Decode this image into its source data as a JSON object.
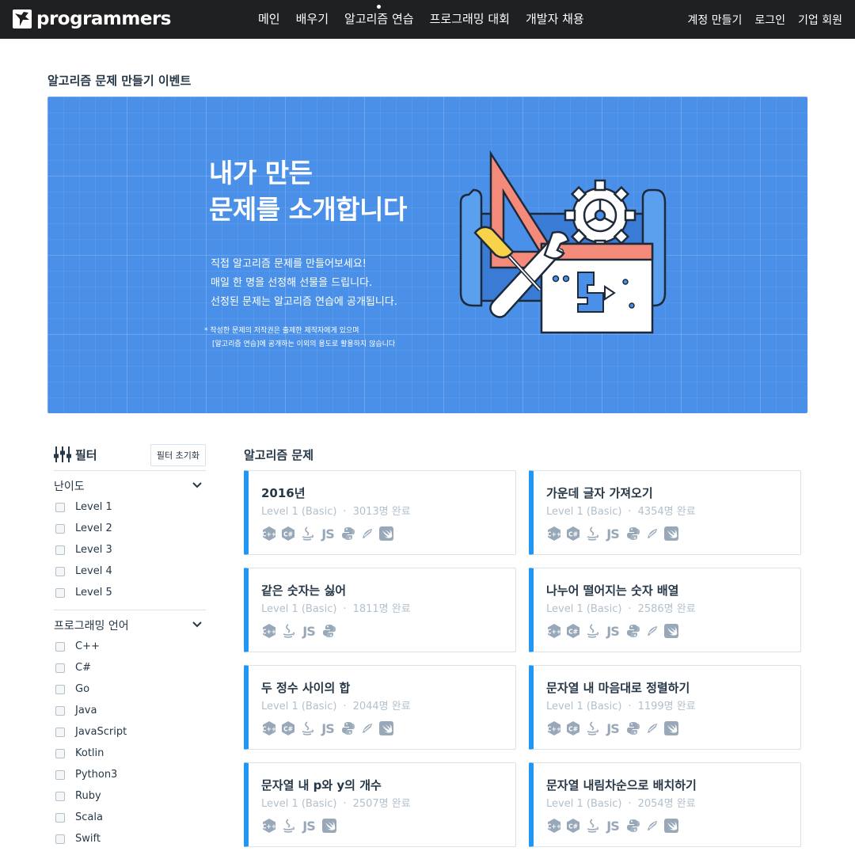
{
  "brand": {
    "name": "programmers"
  },
  "nav": {
    "items": [
      {
        "label": "메인",
        "active": false
      },
      {
        "label": "배우기",
        "active": false
      },
      {
        "label": "알고리즘 연습",
        "active": true
      },
      {
        "label": "프로그래밍 대회",
        "active": false
      },
      {
        "label": "개발자 채용",
        "active": false
      }
    ],
    "right": {
      "signup": "계정 만들기",
      "login": "로그인",
      "company": "기업 회원"
    }
  },
  "event": {
    "section_title": "알고리즘 문제 만들기 이벤트",
    "banner": {
      "headline_1": "내가 만든",
      "headline_2": "문제를 소개합니다",
      "sub_1": "직접 알고리즘 문제를 만들어보세요!",
      "sub_2": "매일 한 명을 선정해 선물을 드립니다.",
      "sub_3": "선정된 문제는 알고리즘 연습에 공개됩니다.",
      "note_1": "*  작성한 문제의 저작권은 출제한 제작자에게 있으며",
      "note_2": "[알고리즘 연습]에 공개하는 이외의 용도로 활용하지 않습니다"
    }
  },
  "filter": {
    "title": "필터",
    "reset_label": "필터 초기화",
    "difficulty": {
      "title": "난이도",
      "options": [
        "Level 1",
        "Level 2",
        "Level 3",
        "Level 4",
        "Level 5"
      ]
    },
    "language": {
      "title": "프로그래밍 언어",
      "options": [
        "C++",
        "C#",
        "Go",
        "Java",
        "JavaScript",
        "Kotlin",
        "Python3",
        "Ruby",
        "Scala",
        "Swift"
      ]
    }
  },
  "problems": {
    "title": "알고리즘 문제",
    "items": [
      {
        "title": "2016년",
        "level": "Level 1 (Basic)",
        "completed": "3013명 완료",
        "langs": [
          "cpp",
          "csharp",
          "java",
          "js",
          "python",
          "scala",
          "swift"
        ]
      },
      {
        "title": "가운데 글자 가져오기",
        "level": "Level 1 (Basic)",
        "completed": "4354명 완료",
        "langs": [
          "cpp",
          "csharp",
          "java",
          "js",
          "python",
          "scala",
          "swift"
        ]
      },
      {
        "title": "같은 숫자는 싫어",
        "level": "Level 1 (Basic)",
        "completed": "1811명 완료",
        "langs": [
          "cpp",
          "java",
          "js",
          "python"
        ]
      },
      {
        "title": "나누어 떨어지는 숫자 배열",
        "level": "Level 1 (Basic)",
        "completed": "2586명 완료",
        "langs": [
          "cpp",
          "csharp",
          "java",
          "js",
          "python",
          "scala",
          "swift"
        ]
      },
      {
        "title": "두 정수 사이의 합",
        "level": "Level 1 (Basic)",
        "completed": "2044명 완료",
        "langs": [
          "cpp",
          "csharp",
          "java",
          "js",
          "python",
          "scala",
          "swift"
        ]
      },
      {
        "title": "문자열 내 마음대로 정렬하기",
        "level": "Level 1 (Basic)",
        "completed": "1199명 완료",
        "langs": [
          "cpp",
          "csharp",
          "java",
          "js",
          "python",
          "scala",
          "swift"
        ]
      },
      {
        "title": "문자열 내 p와 y의 개수",
        "level": "Level 1 (Basic)",
        "completed": "2507명 완료",
        "langs": [
          "cpp",
          "java",
          "js",
          "swift"
        ]
      },
      {
        "title": "문자열 내림차순으로 배치하기",
        "level": "Level 1 (Basic)",
        "completed": "2054명 완료",
        "langs": [
          "cpp",
          "csharp",
          "java",
          "js",
          "python",
          "scala",
          "swift"
        ]
      }
    ]
  },
  "colors": {
    "nav_bg": "#1e2022",
    "accent": "#2196f3",
    "banner_bg": "#4a90e8",
    "text": "#263747",
    "muted": "#b2c0cc",
    "icon": "#98a8b9"
  }
}
